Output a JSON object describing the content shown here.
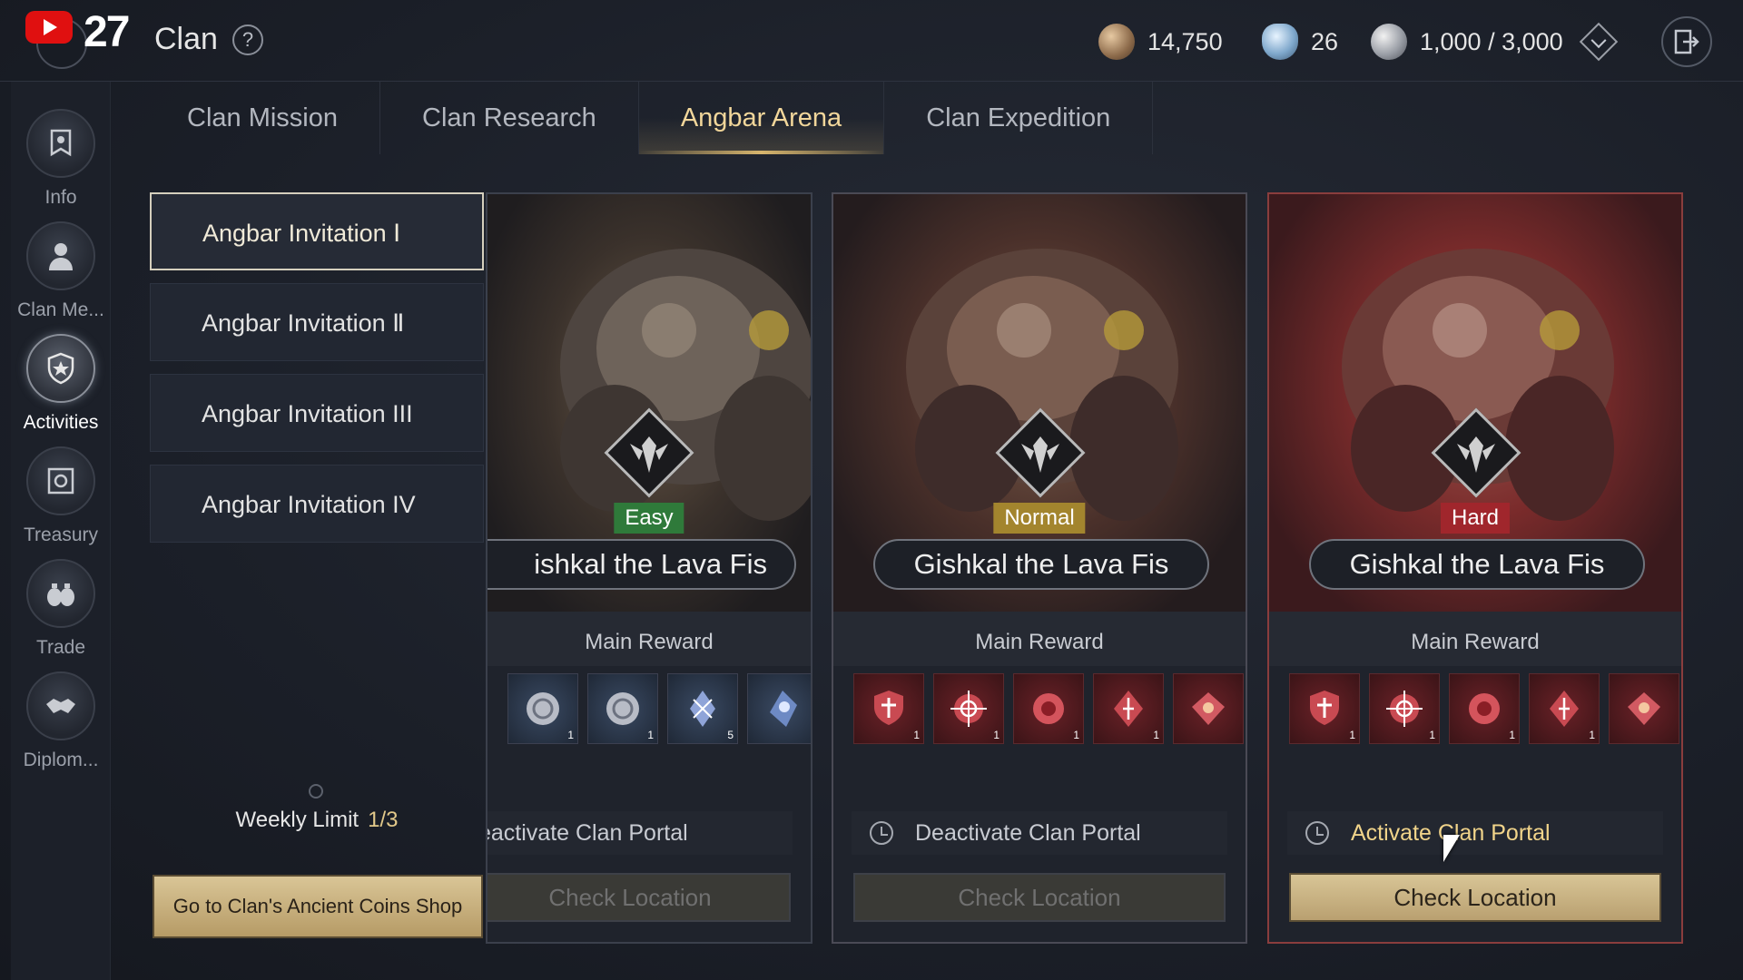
{
  "header": {
    "title": "Clan",
    "help_symbol": "?",
    "video_counter": "27",
    "currencies": [
      {
        "icon": "bronze-coin-icon",
        "value": "14,750"
      },
      {
        "icon": "diamond-icon",
        "value": "26"
      },
      {
        "icon": "silver-coin-icon",
        "value": "1,000 / 3,000"
      }
    ]
  },
  "sidebar": {
    "items": [
      {
        "label": "Info"
      },
      {
        "label": "Clan Me..."
      },
      {
        "label": "Activities"
      },
      {
        "label": "Treasury"
      },
      {
        "label": "Trade"
      },
      {
        "label": "Diplom..."
      }
    ]
  },
  "tabs": [
    {
      "label": "Clan Mission"
    },
    {
      "label": "Clan Research"
    },
    {
      "label": "Angbar Arena"
    },
    {
      "label": "Clan Expedition"
    }
  ],
  "invitations": [
    {
      "label": "Angbar Invitation  Ⅰ"
    },
    {
      "label": "Angbar Invitation  Ⅱ"
    },
    {
      "label": "Angbar Invitation III"
    },
    {
      "label": "Angbar Invitation IV"
    }
  ],
  "weekly_limit": {
    "label": "Weekly Limit",
    "value": "1/3"
  },
  "shop_button": "Go to Clan's Ancient Coins Shop",
  "cards": [
    {
      "difficulty": "Easy",
      "boss_name": "ishkal the Lava Fis",
      "reward_label": "Main Reward",
      "rewards": [
        {
          "icon": "silver-orb-icon",
          "qty": "1"
        },
        {
          "icon": "silver-orb-icon",
          "qty": "1"
        },
        {
          "icon": "crystal-shard-icon",
          "qty": "5"
        },
        {
          "icon": "blue-crystal-icon",
          "qty": ""
        }
      ],
      "portal_text": "eactivate Clan Portal",
      "check_label": "Check Location"
    },
    {
      "difficulty": "Normal",
      "boss_name": "Gishkal the Lava Fis",
      "reward_label": "Main Reward",
      "rewards": [
        {
          "icon": "shield-emblem-icon",
          "qty": "1"
        },
        {
          "icon": "crosshair-emblem-icon",
          "qty": "1"
        },
        {
          "icon": "rose-emblem-icon",
          "qty": "1"
        },
        {
          "icon": "diamond-emblem-icon",
          "qty": "1"
        },
        {
          "icon": "gem-emblem-icon",
          "qty": ""
        }
      ],
      "portal_text": "Deactivate Clan Portal",
      "check_label": "Check Location"
    },
    {
      "difficulty": "Hard",
      "boss_name": "Gishkal the Lava Fis",
      "reward_label": "Main Reward",
      "rewards": [
        {
          "icon": "shield-emblem-icon",
          "qty": "1"
        },
        {
          "icon": "crosshair-emblem-icon",
          "qty": "1"
        },
        {
          "icon": "rose-emblem-icon",
          "qty": "1"
        },
        {
          "icon": "diamond-emblem-icon",
          "qty": "1"
        },
        {
          "icon": "gem-emblem-icon",
          "qty": ""
        }
      ],
      "portal_text": "Activate Clan Portal",
      "check_label": "Check Location"
    }
  ],
  "colors": {
    "accent_gold": "#f2d79b",
    "easy": "#2f7a3a",
    "normal": "#a3852e",
    "hard": "#a0262c"
  }
}
